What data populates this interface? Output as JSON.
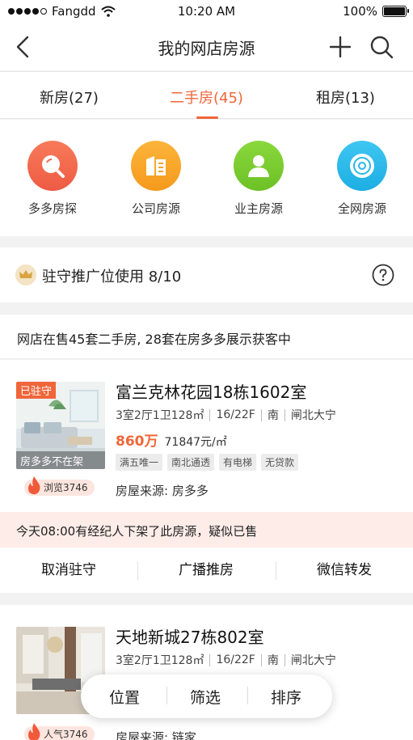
{
  "status_bar": {
    "carrier": "Fangdd",
    "time": "10:20 AM",
    "battery": "100%"
  },
  "nav": {
    "title": "我的网店房源"
  },
  "tabs": [
    {
      "label": "新房(27)",
      "active": false
    },
    {
      "label": "二手房(45)",
      "active": true
    },
    {
      "label": "租房(13)",
      "active": false
    }
  ],
  "sources": [
    {
      "label": "多多房探",
      "icon": "search-icon",
      "color": "#f26a50"
    },
    {
      "label": "公司房源",
      "icon": "building-icon",
      "color": "#f7a325"
    },
    {
      "label": "业主房源",
      "icon": "person-icon",
      "color": "#7ccc2f"
    },
    {
      "label": "全网房源",
      "icon": "target-icon",
      "color": "#28b8ea"
    }
  ],
  "promo": {
    "label": "驻守推广位使用 8/10"
  },
  "summary": {
    "text": "网店在售45套二手房, 28套在房多多展示获客中"
  },
  "listings": [
    {
      "badge": "已驻守",
      "caption": "房多多不在架",
      "title": "富兰克林花园18栋1602室",
      "meta": [
        "3室2厅1卫128㎡",
        "16/22F",
        "南",
        "闸北大宁"
      ],
      "price": "860万",
      "unit_price": "71847元/㎡",
      "tags": [
        "满五唯一",
        "南北通透",
        "有电梯",
        "无贷款"
      ],
      "views": "浏览3746",
      "source": "房屋来源: 房多多",
      "alert": "今天08:00有经纪人下架了此房源，疑似已售",
      "actions": [
        "取消驻守",
        "广播推房",
        "微信转发"
      ]
    },
    {
      "title": "天地新城27栋802室",
      "meta": [
        "3室2厅1卫128㎡",
        "16/22F",
        "南",
        "闸北大宁"
      ],
      "views": "人气3746",
      "source": "房屋来源: 链家"
    }
  ],
  "float_bar": {
    "items": [
      "位置",
      "筛选",
      "排序"
    ]
  }
}
